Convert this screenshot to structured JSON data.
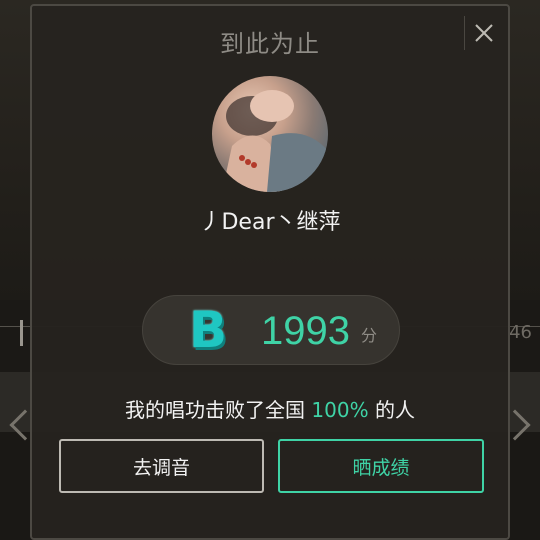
{
  "dialog": {
    "title": "到此为止",
    "close_icon": "close-icon",
    "user": {
      "name": "丿Dear丶继萍"
    },
    "score": {
      "grade": "B",
      "value": "1993",
      "unit": "分"
    },
    "beat": {
      "prefix": "我的唱功击败了全国",
      "percent": "100%",
      "suffix": "的人"
    },
    "buttons": {
      "tune_label": "去调音",
      "share_label": "晒成绩"
    },
    "colors": {
      "accent": "#3fd3a6",
      "grade": "#1fc7c2"
    }
  },
  "background": {
    "number": "46"
  }
}
